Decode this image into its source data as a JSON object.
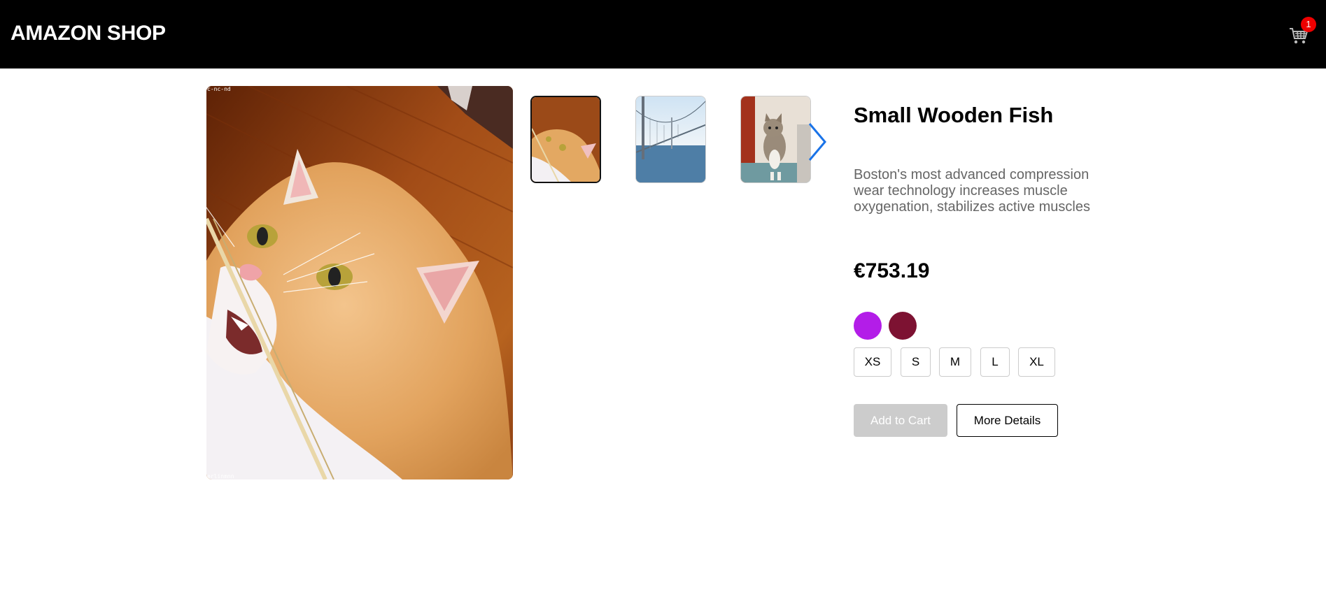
{
  "header": {
    "brand": "AMAZON SHOP",
    "cart_icon": "cart-icon",
    "cart_count": "1"
  },
  "gallery": {
    "main_image": "orange-white-cat-photo",
    "watermark_top": "c-nc-nd",
    "watermark_bottom": "erlinmnn",
    "thumbnails": [
      {
        "name": "cat-thumbnail",
        "selected": true
      },
      {
        "name": "bridge-thumbnail",
        "selected": false
      },
      {
        "name": "kitten-thumbnail",
        "selected": false
      }
    ],
    "next_icon": "chevron-right-icon"
  },
  "product": {
    "title": "Small Wooden Fish",
    "description": "Boston's most advanced compression wear technology increases muscle oxygenation, stabilizes active muscles",
    "price": "€753.19",
    "colors": [
      "#b31de8",
      "#7d1232"
    ],
    "sizes": [
      "XS",
      "S",
      "M",
      "L",
      "XL"
    ],
    "add_to_cart": "Add to Cart",
    "more_details": "More Details"
  },
  "colors": {
    "header_bg": "#000000",
    "badge": "#ee0000",
    "arrow": "#1a73e8",
    "disabled_button": "#cccccc"
  }
}
